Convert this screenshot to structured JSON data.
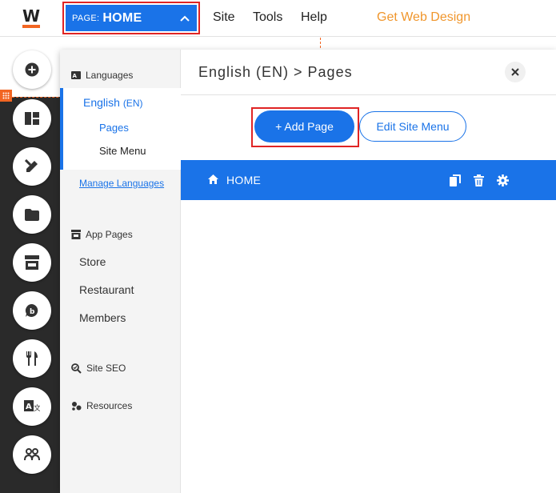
{
  "topbar": {
    "logo_letter": "W",
    "page_selector": {
      "prefix": "PAGE:",
      "page_name": "HOME"
    },
    "nav": [
      "Site",
      "Tools",
      "Help"
    ],
    "cta": "Get Web Design"
  },
  "rail": {
    "icons": [
      "add-icon",
      "layout-icon",
      "design-icon",
      "folder-icon",
      "store-icon",
      "blog-icon",
      "restaurant-icon",
      "translate-icon",
      "members-icon"
    ]
  },
  "panel": {
    "nav": {
      "languages_heading": "Languages",
      "language": {
        "name": "English",
        "code": "(EN)"
      },
      "sub_items": [
        "Pages",
        "Site Menu"
      ],
      "manage_languages": "Manage Languages",
      "app_pages_heading": "App Pages",
      "app_pages": [
        "Store",
        "Restaurant",
        "Members"
      ],
      "site_seo": "Site SEO",
      "resources": "Resources"
    },
    "main": {
      "title": "English (EN) > Pages",
      "add_page_label": "+ Add Page",
      "edit_menu_label": "Edit Site Menu",
      "pages": [
        {
          "name": "HOME"
        }
      ]
    }
  },
  "colors": {
    "accent": "#1a73e8",
    "brand_orange": "#f26522",
    "cta": "#f0962c",
    "highlight_border": "#e02424"
  }
}
